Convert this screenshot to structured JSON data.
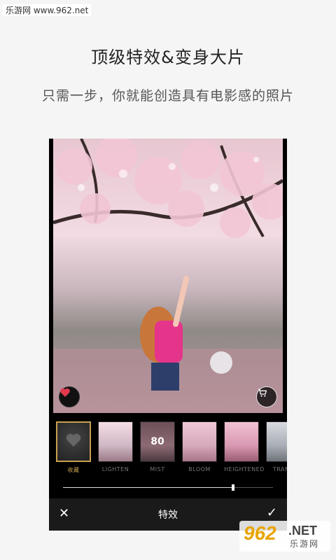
{
  "watermark_top": "乐游网 www.962.net",
  "headline": "顶级特效&变身大片",
  "subline": "只需一步，你就能创造具有电影感的照片",
  "filters": [
    {
      "label": "收藏",
      "active": true
    },
    {
      "label": "LIGHTEN"
    },
    {
      "label": "MIST",
      "value": "80"
    },
    {
      "label": "BLOOM"
    },
    {
      "label": "HEIGHTENED"
    },
    {
      "label": "TRANQ"
    }
  ],
  "slider": {
    "value": 0.81
  },
  "bottom_bar": {
    "title": "特效"
  },
  "logo": {
    "number": "962",
    "domain": ".NET",
    "cn": "乐游网"
  },
  "colors": {
    "accent": "#c9a14f",
    "favorite": "#e03a4c"
  }
}
